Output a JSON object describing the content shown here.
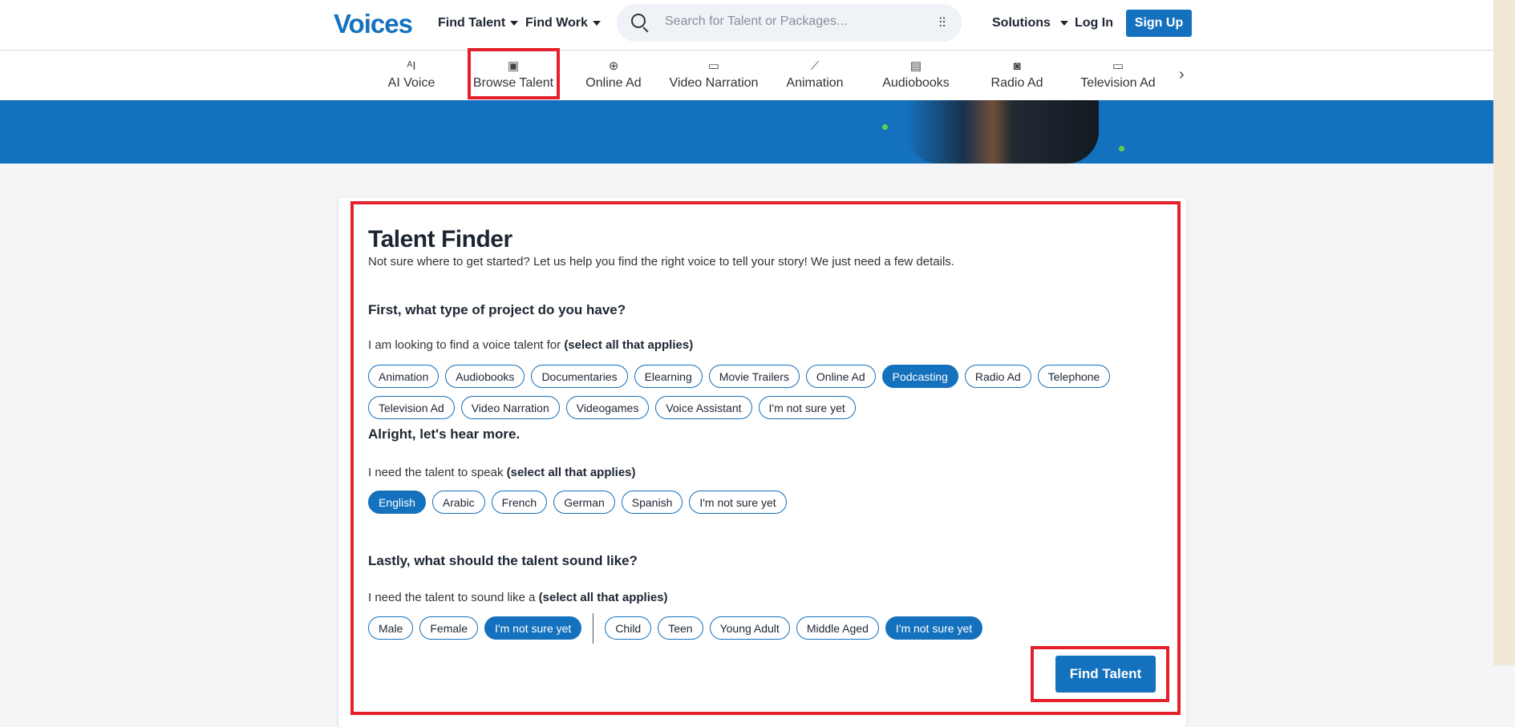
{
  "header": {
    "logo": "Voices",
    "find_talent": "Find Talent",
    "find_work": "Find Work",
    "search_placeholder": "Search for Talent or Packages...",
    "solutions": "Solutions",
    "login": "Log In",
    "signup": "Sign Up"
  },
  "categories": [
    {
      "label": "AI Voice",
      "icon": "ai-icon",
      "glyph": "ᴬI"
    },
    {
      "label": "Browse Talent",
      "icon": "id-card-icon",
      "glyph": "▣"
    },
    {
      "label": "Online Ad",
      "icon": "globe-icon",
      "glyph": "⊕"
    },
    {
      "label": "Video Narration",
      "icon": "video-camera-icon",
      "glyph": "▭"
    },
    {
      "label": "Animation",
      "icon": "magic-wand-icon",
      "glyph": "⟋"
    },
    {
      "label": "Audiobooks",
      "icon": "book-icon",
      "glyph": "▤"
    },
    {
      "label": "Radio Ad",
      "icon": "radio-icon",
      "glyph": "◙"
    },
    {
      "label": "Television Ad",
      "icon": "tv-icon",
      "glyph": "▭"
    }
  ],
  "finder": {
    "title": "Talent Finder",
    "subtitle": "Not sure where to get started? Let us help you find the right voice to tell your story! We just need a few details.",
    "q1": "First, what type of project do you have?",
    "q1_label": "I am looking to find a voice talent for ",
    "select_all": "(select all that applies)",
    "projects": [
      {
        "label": "Animation"
      },
      {
        "label": "Audiobooks"
      },
      {
        "label": "Documentaries"
      },
      {
        "label": "Elearning"
      },
      {
        "label": "Movie Trailers"
      },
      {
        "label": "Online Ad"
      },
      {
        "label": "Podcasting",
        "selected": true
      },
      {
        "label": "Radio Ad"
      },
      {
        "label": "Telephone"
      },
      {
        "label": "Television Ad"
      },
      {
        "label": "Video Narration"
      },
      {
        "label": "Videogames"
      },
      {
        "label": "Voice Assistant"
      },
      {
        "label": "I'm not sure yet"
      }
    ],
    "q2": "Alright, let's hear more.",
    "q2_label": "I need the talent to speak ",
    "languages": [
      {
        "label": "English",
        "selected": true
      },
      {
        "label": "Arabic"
      },
      {
        "label": "French"
      },
      {
        "label": "German"
      },
      {
        "label": "Spanish"
      },
      {
        "label": "I'm not sure yet"
      }
    ],
    "q3": "Lastly, what should the talent sound like?",
    "q3_label": "I need the talent to sound like a ",
    "genders": [
      {
        "label": "Male"
      },
      {
        "label": "Female"
      },
      {
        "label": "I'm not sure yet",
        "selected": true
      }
    ],
    "ages": [
      {
        "label": "Child"
      },
      {
        "label": "Teen"
      },
      {
        "label": "Young Adult"
      },
      {
        "label": "Middle Aged"
      },
      {
        "label": "I'm not sure yet",
        "selected": true
      }
    ],
    "submit": "Find Talent"
  },
  "colors": {
    "brand": "#1471bd",
    "highlight": "#e3202b"
  }
}
